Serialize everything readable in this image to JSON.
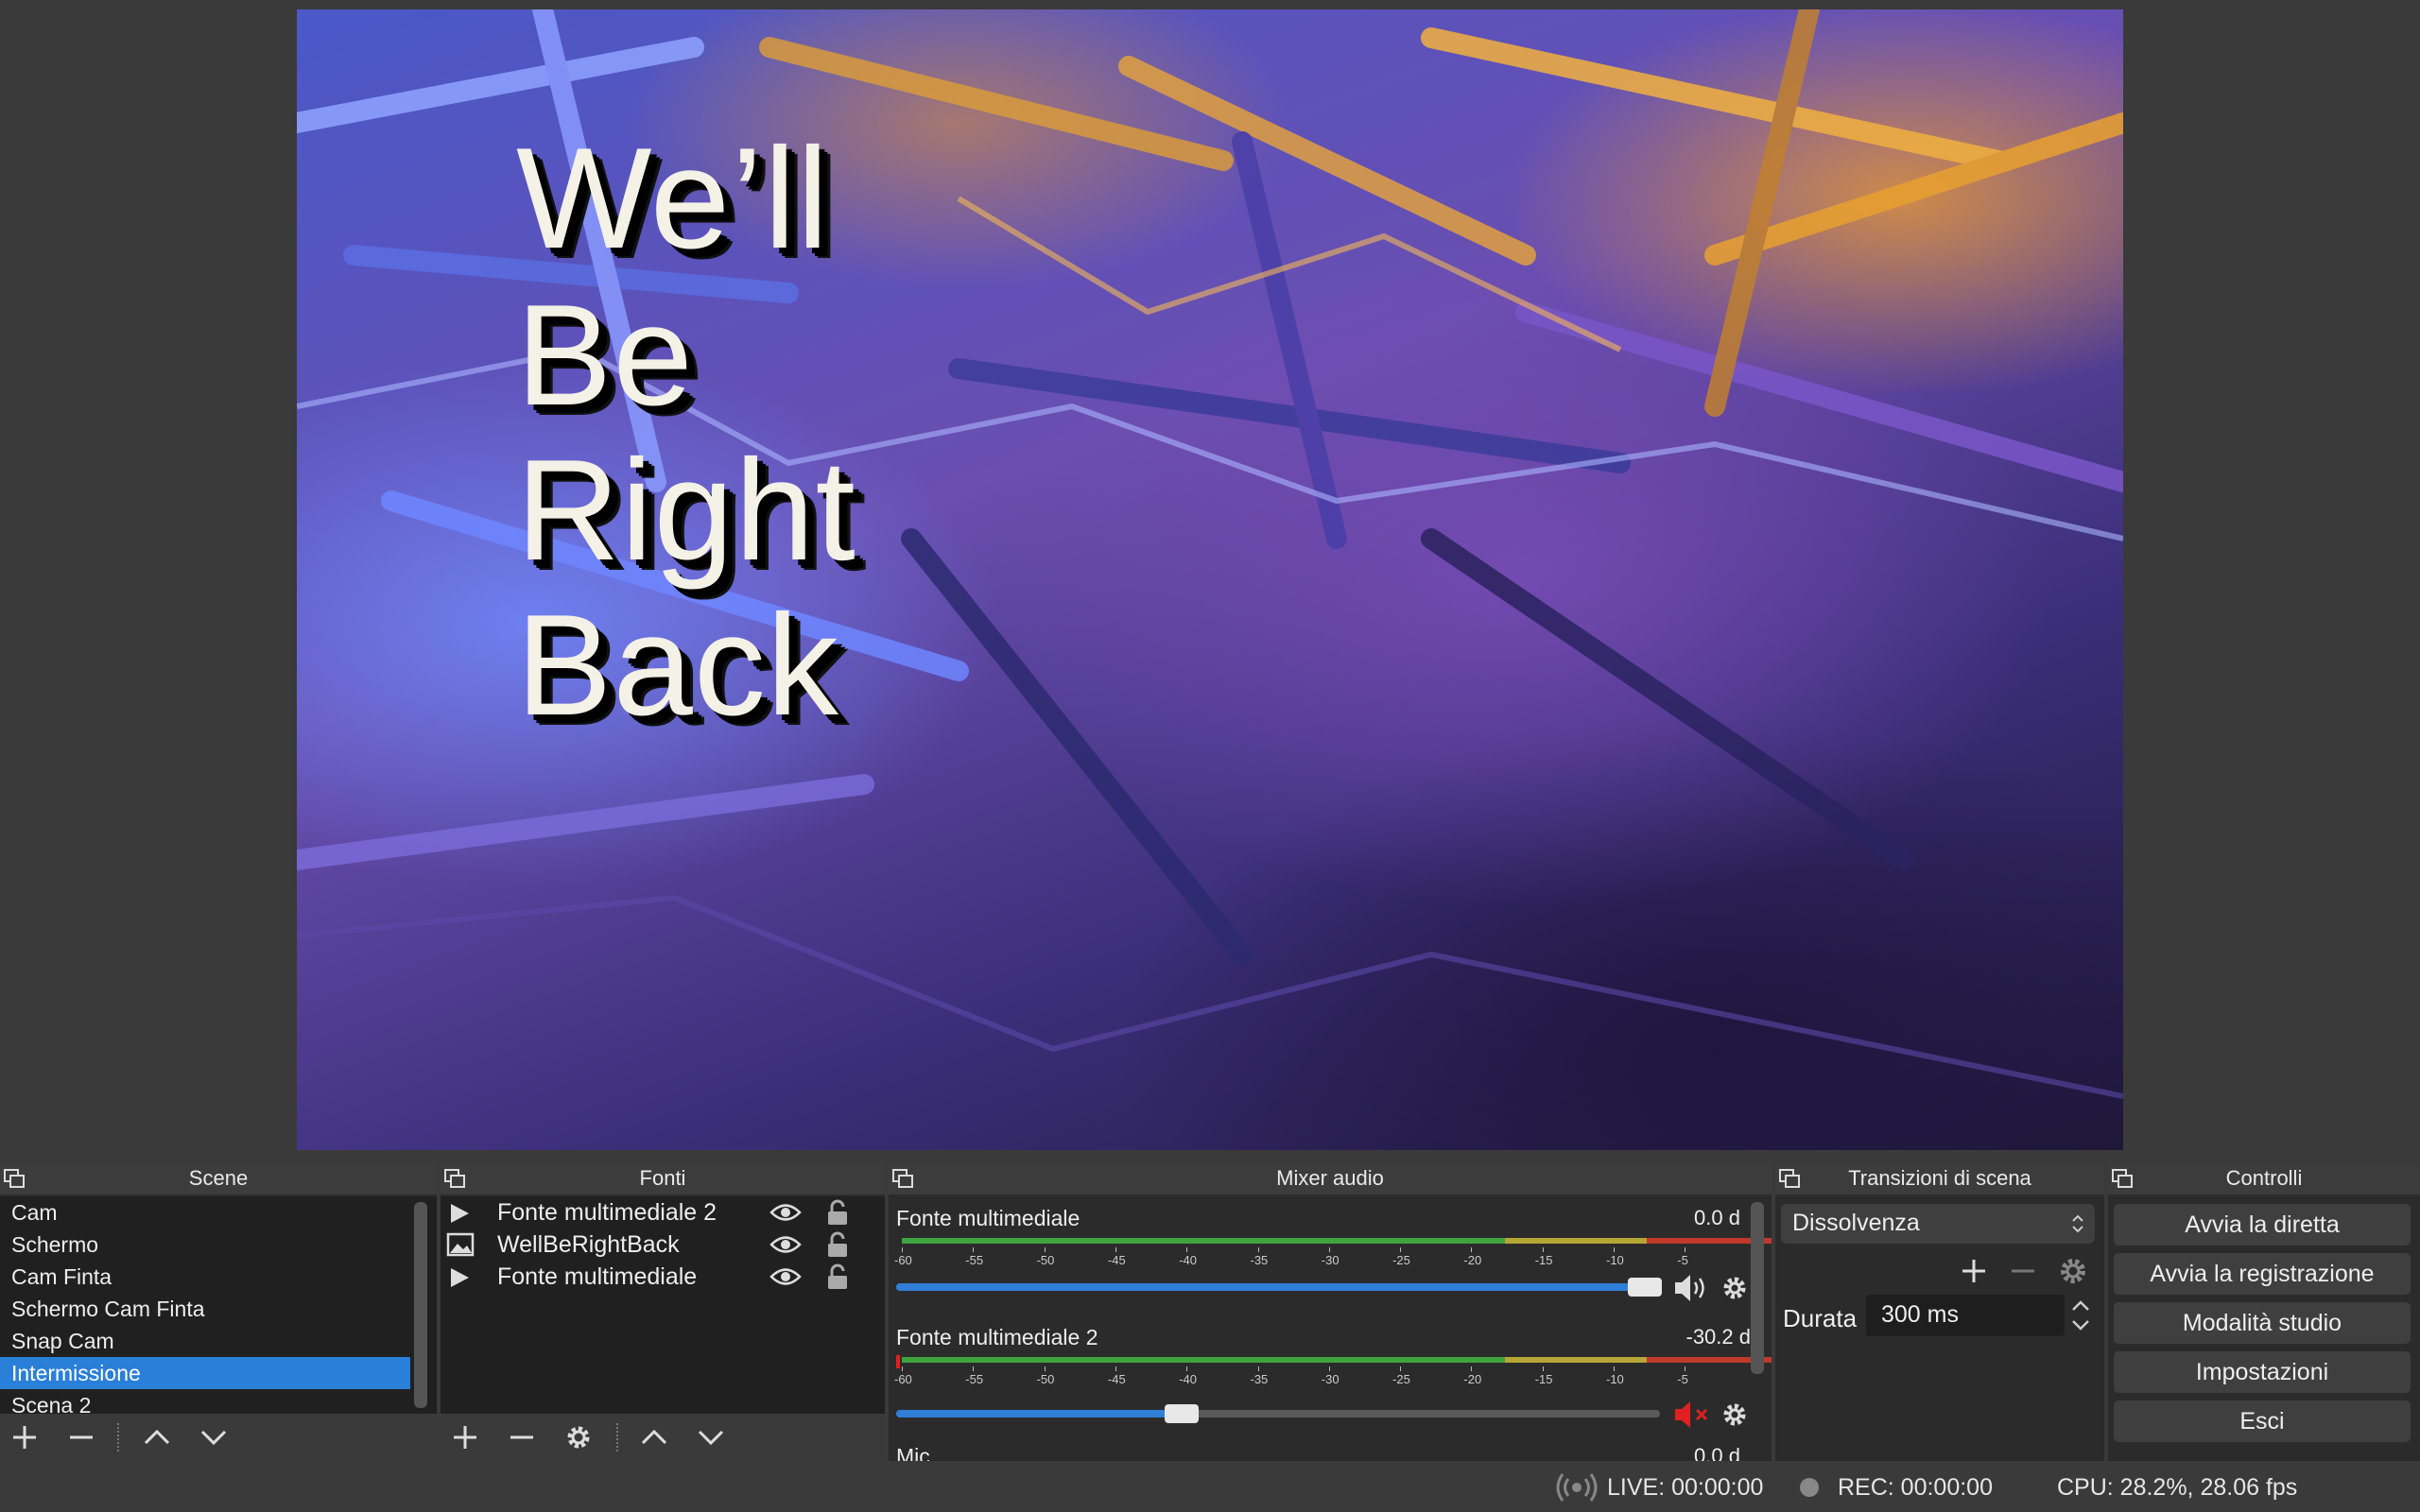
{
  "preview": {
    "overlay_lines": [
      "We’ll",
      "Be",
      "Right",
      "Back"
    ]
  },
  "scenes": {
    "title": "Scene",
    "items": [
      "Cam",
      "Schermo",
      "Cam Finta",
      "Schermo Cam Finta",
      "Snap Cam",
      "Intermissione",
      "Scena 2"
    ],
    "selected": "Intermissione",
    "selection_color": "#2a7fd9"
  },
  "sources": {
    "title": "Fonti",
    "items": [
      {
        "name": "Fonte multimediale 2",
        "icon": "media-play-icon"
      },
      {
        "name": "WellBeRightBack",
        "icon": "image-icon"
      },
      {
        "name": "Fonte multimediale",
        "icon": "media-play-icon"
      }
    ]
  },
  "mixer": {
    "title": "Mixer audio",
    "scale_labels": [
      "-60",
      "-55",
      "-50",
      "-45",
      "-40",
      "-35",
      "-30",
      "-25",
      "-20",
      "-15",
      "-10",
      "-5"
    ],
    "channels": [
      {
        "name": "Fonte multimediale",
        "db": "0.0 d",
        "volume_fraction": 1.0,
        "muted": false
      },
      {
        "name": "Fonte multimediale 2",
        "db": "-30.2 d",
        "volume_fraction": 0.38,
        "muted": true
      }
    ],
    "partial_channel": {
      "name": "Mic...",
      "db": "0.0 d"
    }
  },
  "transitions": {
    "title": "Transizioni di scena",
    "selected": "Dissolvenza",
    "duration_label": "Durata",
    "duration_value": "300 ms"
  },
  "controls": {
    "title": "Controlli",
    "buttons": [
      "Avvia la diretta",
      "Avvia la registrazione",
      "Modalità studio",
      "Impostazioni",
      "Esci"
    ]
  },
  "status": {
    "live": "LIVE: 00:00:00",
    "rec": "REC: 00:00:00",
    "cpu": "CPU: 28.2%, 28.06 fps"
  },
  "colors": {
    "meter_green": "#3fa33f",
    "meter_yellow": "#b5a636",
    "meter_red": "#c0392b",
    "accent_blue": "#2f7fd8",
    "mute_red": "#e02020"
  }
}
